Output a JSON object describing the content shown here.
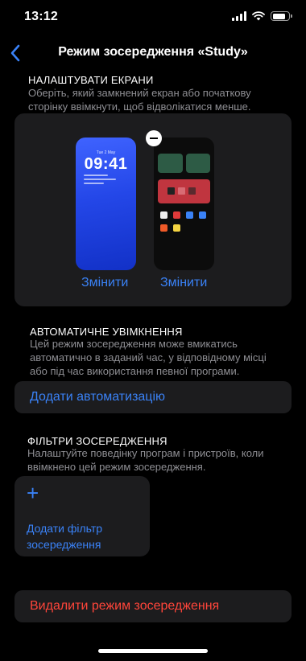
{
  "status_bar": {
    "time": "13:12",
    "signal_bars": 4,
    "battery_percent": 80
  },
  "nav": {
    "title": "Режим зосередження «Study»",
    "back_icon": "chevron-left-icon"
  },
  "screens_section": {
    "header": "НАЛАШТУВАТИ ЕКРАНИ",
    "footer": "Оберіть, який замкнений екран або початкову сторінку ввімкнути, щоб відволікатися менше.",
    "lock_screen": {
      "date": "Tue 2 May",
      "time": "09:41",
      "change_label": "Змінити"
    },
    "home_screen": {
      "change_label": "Змінити"
    }
  },
  "automation_section": {
    "header": "АВТОМАТИЧНЕ УВІМКНЕННЯ",
    "footer": "Цей режим зосередження може вмикатись автоматично в заданий час, у відповідному місці або під час використання певної програми.",
    "add_label": "Додати автоматизацію"
  },
  "filters_section": {
    "header": "ФІЛЬТРИ ЗОСЕРЕДЖЕННЯ",
    "footer": "Налаштуйте поведінку програм і пристроїв, коли ввімкнено цей режим зосередження.",
    "add_filter_label": "Додати фільтр зосередження"
  },
  "delete_label": "Видалити режим зосередження",
  "colors": {
    "accent": "#3a82f7",
    "destructive": "#ff453a",
    "card": "#1c1c1e",
    "secondary_text": "#8e8e93"
  }
}
